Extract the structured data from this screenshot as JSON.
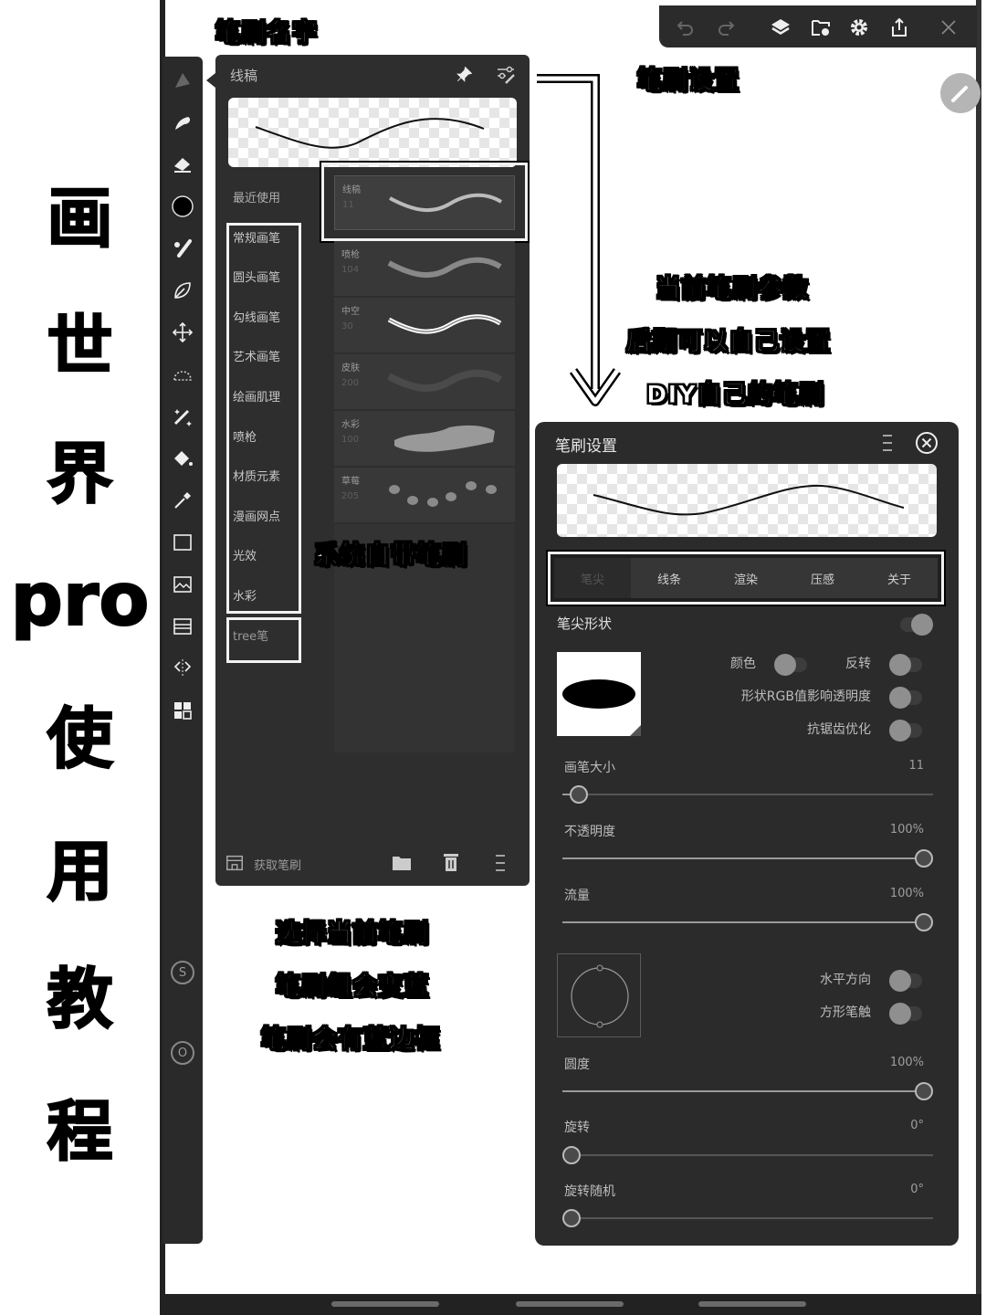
{
  "left_title": [
    "画",
    "世",
    "界",
    "pro",
    "使",
    "用",
    "教",
    "程"
  ],
  "annotations": {
    "brush_name": "笔刷名字",
    "brush_settings": "笔刷设置",
    "params": [
      "当前笔刷参数",
      "后期可以自己设置",
      "DIY自己的笔刷"
    ],
    "system_brushes": "系统自带笔刷",
    "select": [
      "选择当前笔刷",
      "笔刷组会变蓝",
      "笔刷会有蓝边框"
    ]
  },
  "topbar": {
    "icons": [
      "undo-icon",
      "redo-icon",
      "layers-icon",
      "folder-cloud-icon",
      "gear-icon",
      "share-icon",
      "close-icon"
    ]
  },
  "toolrail": {
    "tools": [
      "brush-pen-icon",
      "smudge-icon",
      "eraser-icon",
      "color-swatch-icon",
      "brushes-icon",
      "leaf-lasso-icon",
      "move-icon",
      "selection-icon",
      "magic-wand-icon",
      "fill-bucket-icon",
      "eyedropper-icon",
      "rectangle-icon",
      "image-icon",
      "filter-icon",
      "symmetry-icon",
      "grid-icon"
    ],
    "bottom_buttons": [
      "S",
      "O"
    ]
  },
  "brush_panel": {
    "title": "线稿",
    "recent_label": "最近使用",
    "categories": [
      "常规画笔",
      "圆头画笔",
      "勾线画笔",
      "艺术画笔",
      "绘画肌理",
      "喷枪",
      "材质元素",
      "漫画网点",
      "光效",
      "水彩"
    ],
    "custom_category": "tree笔",
    "brushes": [
      {
        "name": "线稿",
        "size": "11"
      },
      {
        "name": "喷枪",
        "size": "104"
      },
      {
        "name": "中空",
        "size": "30"
      },
      {
        "name": "皮肤",
        "size": "200"
      },
      {
        "name": "水彩",
        "size": "100"
      },
      {
        "name": "草莓",
        "size": "205"
      }
    ],
    "footer": {
      "get_brushes": "获取笔刷"
    }
  },
  "settings_panel": {
    "title": "笔刷设置",
    "tabs": [
      "笔尖",
      "线条",
      "渲染",
      "压感",
      "关于"
    ],
    "active_tab": "笔尖",
    "tip_shape_label": "笔尖形状",
    "tip_shape_enabled": true,
    "options": {
      "color": {
        "label": "颜色",
        "on": false
      },
      "invert": {
        "label": "反转",
        "on": false
      },
      "rgb_alpha": {
        "label": "形状RGB值影响透明度",
        "on": false
      },
      "antialias": {
        "label": "抗锯齿优化",
        "on": false
      },
      "horizontal": {
        "label": "水平方向",
        "on": false
      },
      "square": {
        "label": "方形笔触",
        "on": false
      }
    },
    "sliders": [
      {
        "label": "画笔大小",
        "value_text": "11",
        "fraction": 0.02
      },
      {
        "label": "不透明度",
        "value_text": "100%",
        "fraction": 1.0
      },
      {
        "label": "流量",
        "value_text": "100%",
        "fraction": 1.0
      },
      {
        "label": "圆度",
        "value_text": "100%",
        "fraction": 1.0
      },
      {
        "label": "旋转",
        "value_text": "0°",
        "fraction": 0.0
      },
      {
        "label": "旋转随机",
        "value_text": "0°",
        "fraction": 0.0
      }
    ]
  }
}
